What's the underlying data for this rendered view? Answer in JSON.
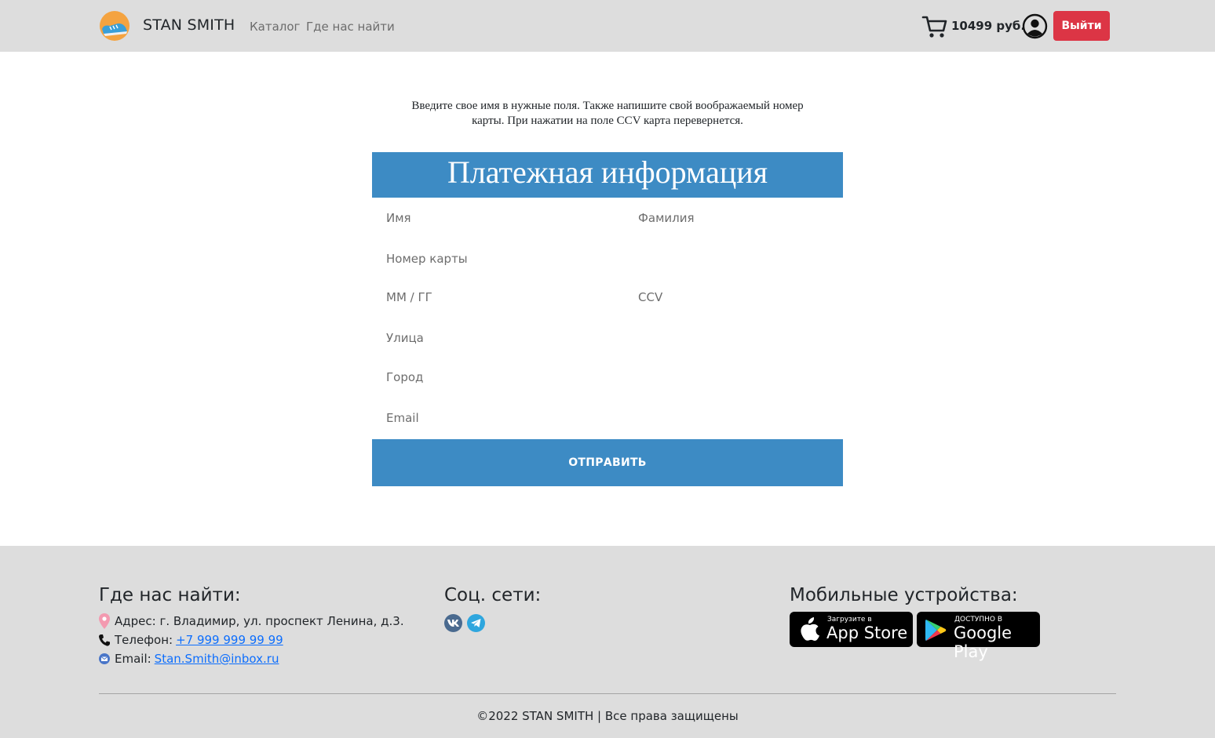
{
  "header": {
    "brand": "STAN SMITH",
    "nav": {
      "catalog": "Каталог",
      "find_us": "Где нас найти"
    },
    "cart_total": "10499 руб.",
    "logout_label": "Выйти",
    "logout_color": "#dc3545"
  },
  "main": {
    "intro_line1": "Введите свое имя в нужные поля. Также напишите свой воображаемый номер",
    "intro_line2": "карты. При нажатии на поле CCV карта перевернется.",
    "form_title": "Платежная информация",
    "fields": {
      "first_name": "Имя",
      "last_name": "Фамилия",
      "card_number": "Номер карты",
      "expiry": "ММ / ГГ",
      "ccv": "CCV",
      "street": "Улица",
      "city": "Город",
      "email": "Email"
    },
    "submit_label": "ОТПРАВИТЬ",
    "accent_color": "#3d8bc4"
  },
  "footer": {
    "find_us_heading": "Где нас найти:",
    "address": "Адрес: г. Владимир, ул. проспект Ленина, д.3.",
    "phone_label": "Телефон:",
    "phone_value": "+7 999 999 99 99",
    "email_label": "Email:",
    "email_value": "Stan.Smith@inbox.ru",
    "social_heading": "Соц. сети:",
    "social_icons": [
      "vk-icon",
      "telegram-icon"
    ],
    "mobile_heading": "Мобильные устройства:",
    "appstore_small": "Загрузите в",
    "appstore_big": "App Store",
    "googleplay_small": "ДОСТУПНО В",
    "googleplay_big": "Google Play",
    "copyright": "©2022 STAN SMITH | Все права защищены"
  }
}
